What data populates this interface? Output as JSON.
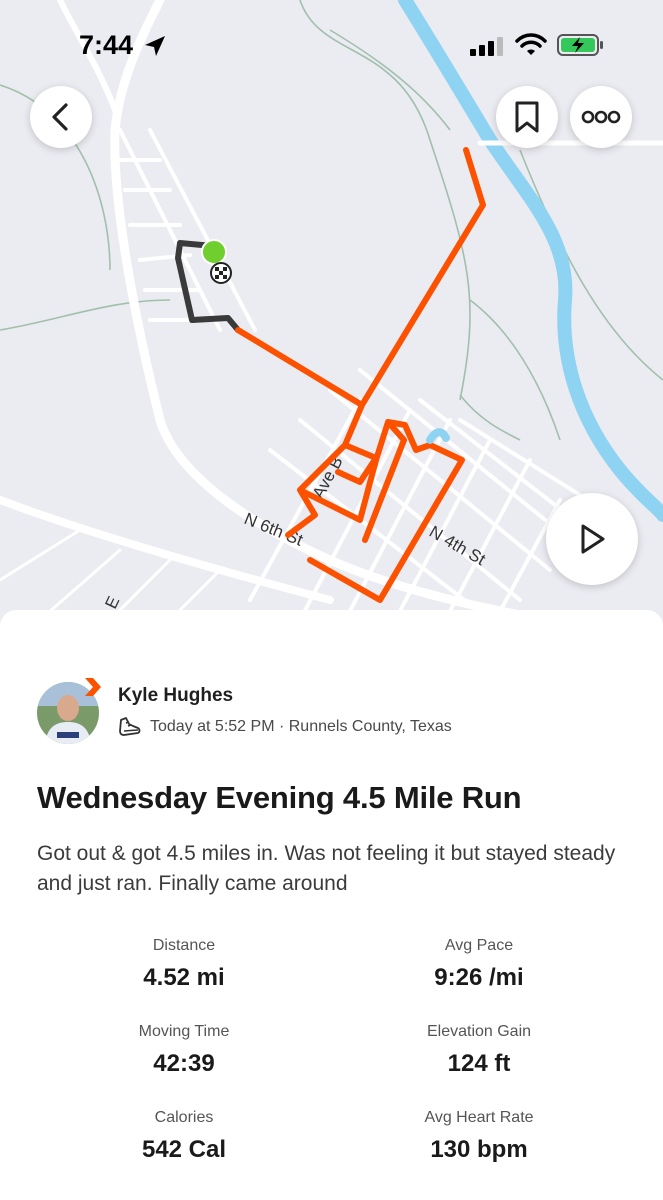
{
  "status_bar": {
    "time": "7:44"
  },
  "map": {
    "street_labels": [
      "N 6th St",
      "Ave B",
      "N 4th St",
      "E"
    ],
    "colors": {
      "route": "#fc5200",
      "route_other": "#3a3a3a",
      "start": "#6fcf2e",
      "water": "#8fd3f2",
      "land": "#ebebf2"
    }
  },
  "activity": {
    "athlete": {
      "name": "Kyle Hughes"
    },
    "meta": "Today at 5:52 PM · Runnels County, Texas",
    "title": "Wednesday Evening 4.5 Mile Run",
    "description": "Got out & got 4.5 miles in. Was not feeling it but stayed steady and just ran. Finally came around",
    "stats": [
      {
        "label": "Distance",
        "value": "4.52 mi"
      },
      {
        "label": "Avg Pace",
        "value": "9:26 /mi"
      },
      {
        "label": "Moving Time",
        "value": "42:39"
      },
      {
        "label": "Elevation Gain",
        "value": "124 ft"
      },
      {
        "label": "Calories",
        "value": "542 Cal"
      },
      {
        "label": "Avg Heart Rate",
        "value": "130 bpm"
      }
    ]
  },
  "icons": {
    "back": "chevron-left-icon",
    "bookmark": "bookmark-icon",
    "more": "more-icon",
    "play": "play-icon",
    "activity_type": "shoe-icon"
  }
}
